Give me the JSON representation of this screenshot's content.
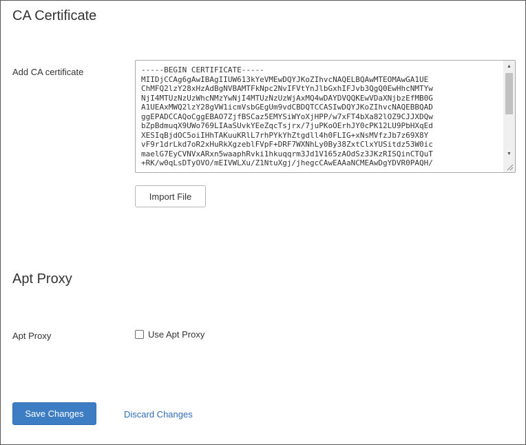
{
  "ca_section": {
    "title": "CA Certificate",
    "field_label": "Add CA certificate",
    "certificate_text": "-----BEGIN CERTIFICATE-----\nMIIDjCCAg6gAwIBAgIIUW613kYeVMEwDQYJKoZIhvcNAQELBQAwMTEOMAwGA1UE\nChMFQ2lzY28xHzAdBgNVBAMTFkNpc2NvIFVtYnJlbGxhIFJvb3QgQ0EwHhcNMTYw\nNjI4MTUzNzUzWhcNMzYwNjI4MTUzNzUzWjAxMQ4wDAYDVQQKEwVDaXNjbzEfMB0G\nA1UEAxMWQ2lzY28gVW1icmVsbGEgUm9vdCBDQTCCASIwDQYJKoZIhvcNAQEBBQAD\nggEPADCCAQoCggEBAO7ZjfBSCaz5EMYSiWYoXjHPP/w7xFT4bXa82lOZ9CJJXDQw\nbZpBdmuqX9UWo769LIAaSUvkYEeZqcTsjrx/7juPKoOErhJY0cPK12LU9PbHXqEd\nXESIqBjdOC5oiIHhTAKuuKRlL7rhPYkYhZtgdll4h0FLIG+xNsMVfzJb7z69X8Y\nvF9r1drLkd7oR2xHuRkXgzeblFVpF+DRF7WXNhLy0By38ZxtClxYUSitdz53W0ic\nmaelG7EyCVNVxARxn5waaphRvki1hkuqqrm3Jd1V165zAOdSz3JKzRISQinCTQuT\n+RK/w0qLsDTyOVO/mEIVWLXu/Z1NtuXgj/jhegcCAwEAAaNCMEAwDgYDVR0PAQH/",
    "import_button_label": "Import File"
  },
  "apt_section": {
    "title": "Apt Proxy",
    "field_label": "Apt Proxy",
    "checkbox_label": "Use Apt Proxy",
    "checkbox_checked": false
  },
  "footer": {
    "save_label": "Save Changes",
    "discard_label": "Discard Changes"
  },
  "colors": {
    "primary_button": "#3c7dc4",
    "link": "#2f6db5",
    "text": "#333333"
  }
}
